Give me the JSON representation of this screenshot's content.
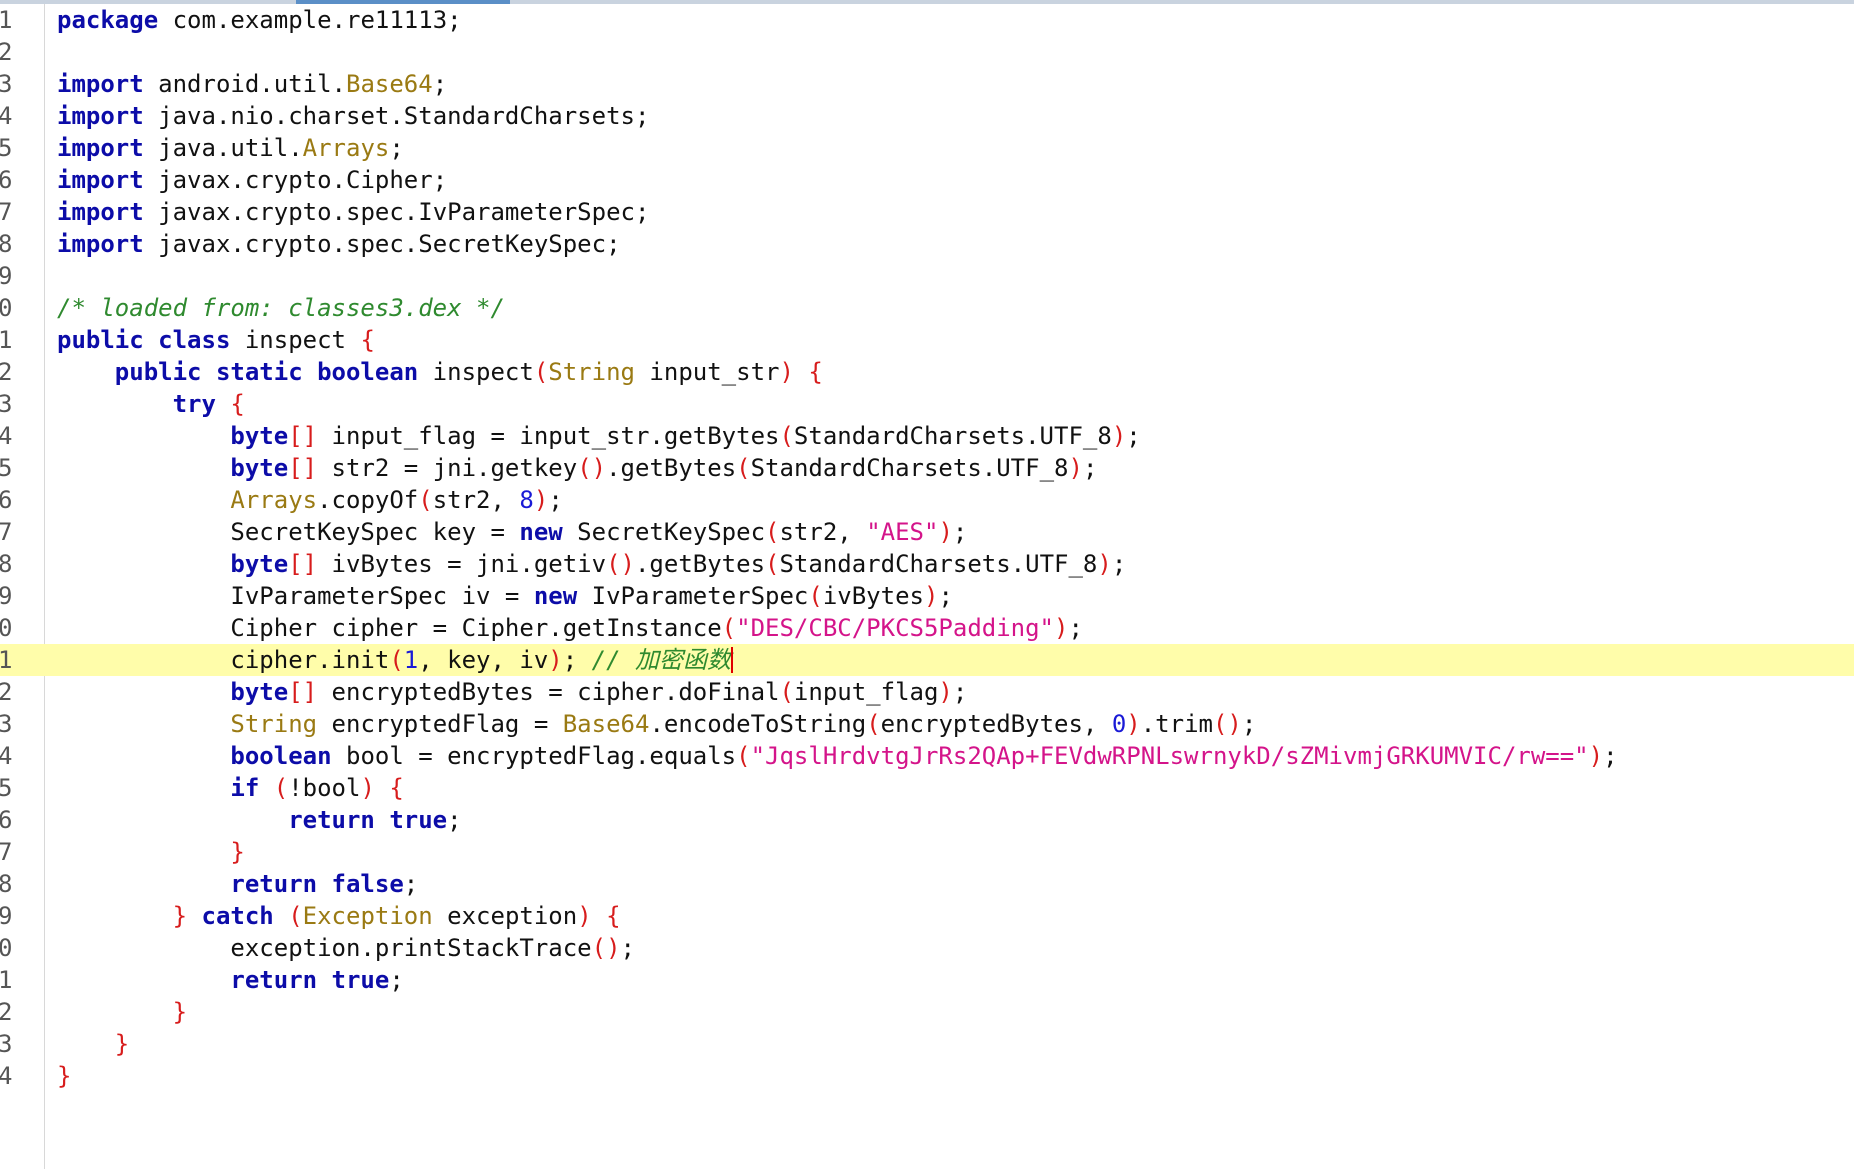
{
  "editor": {
    "current_line": 21,
    "lines": [
      {
        "n": "1",
        "tokens": [
          {
            "t": "kw",
            "v": "package"
          },
          {
            "t": "",
            "v": " com.example.re11113;"
          }
        ]
      },
      {
        "n": "2",
        "tokens": []
      },
      {
        "n": "3",
        "tokens": [
          {
            "t": "kw",
            "v": "import"
          },
          {
            "t": "",
            "v": " android.util."
          },
          {
            "t": "cls",
            "v": "Base64"
          },
          {
            "t": "",
            "v": ";"
          }
        ]
      },
      {
        "n": "4",
        "tokens": [
          {
            "t": "kw",
            "v": "import"
          },
          {
            "t": "",
            "v": " java.nio.charset.StandardCharsets;"
          }
        ]
      },
      {
        "n": "5",
        "tokens": [
          {
            "t": "kw",
            "v": "import"
          },
          {
            "t": "",
            "v": " java.util."
          },
          {
            "t": "cls",
            "v": "Arrays"
          },
          {
            "t": "",
            "v": ";"
          }
        ]
      },
      {
        "n": "6",
        "tokens": [
          {
            "t": "kw",
            "v": "import"
          },
          {
            "t": "",
            "v": " javax.crypto.Cipher;"
          }
        ]
      },
      {
        "n": "7",
        "tokens": [
          {
            "t": "kw",
            "v": "import"
          },
          {
            "t": "",
            "v": " javax.crypto.spec.IvParameterSpec;"
          }
        ]
      },
      {
        "n": "8",
        "tokens": [
          {
            "t": "kw",
            "v": "import"
          },
          {
            "t": "",
            "v": " javax.crypto.spec.SecretKeySpec;"
          }
        ]
      },
      {
        "n": "9",
        "tokens": []
      },
      {
        "n": "0",
        "tokens": [
          {
            "t": "cmt",
            "v": "/* loaded from: classes3.dex */"
          }
        ]
      },
      {
        "n": "1",
        "tokens": [
          {
            "t": "kw",
            "v": "public class"
          },
          {
            "t": "",
            "v": " inspect "
          },
          {
            "t": "br",
            "v": "{"
          }
        ]
      },
      {
        "n": "2",
        "tokens": [
          {
            "t": "",
            "v": "    "
          },
          {
            "t": "kw",
            "v": "public static boolean"
          },
          {
            "t": "",
            "v": " inspect"
          },
          {
            "t": "br",
            "v": "("
          },
          {
            "t": "cls",
            "v": "String"
          },
          {
            "t": "",
            "v": " input_str"
          },
          {
            "t": "br",
            "v": ")"
          },
          {
            "t": "",
            "v": " "
          },
          {
            "t": "br",
            "v": "{"
          }
        ]
      },
      {
        "n": "3",
        "tokens": [
          {
            "t": "",
            "v": "        "
          },
          {
            "t": "kw",
            "v": "try"
          },
          {
            "t": "",
            "v": " "
          },
          {
            "t": "br",
            "v": "{"
          }
        ]
      },
      {
        "n": "4",
        "tokens": [
          {
            "t": "",
            "v": "            "
          },
          {
            "t": "kw",
            "v": "byte"
          },
          {
            "t": "br",
            "v": "[]"
          },
          {
            "t": "",
            "v": " input_flag = input_str.getBytes"
          },
          {
            "t": "br",
            "v": "("
          },
          {
            "t": "",
            "v": "StandardCharsets.UTF_8"
          },
          {
            "t": "br",
            "v": ")"
          },
          {
            "t": "",
            "v": ";"
          }
        ]
      },
      {
        "n": "5",
        "tokens": [
          {
            "t": "",
            "v": "            "
          },
          {
            "t": "kw",
            "v": "byte"
          },
          {
            "t": "br",
            "v": "[]"
          },
          {
            "t": "",
            "v": " str2 = jni.getkey"
          },
          {
            "t": "br",
            "v": "()"
          },
          {
            "t": "",
            "v": ".getBytes"
          },
          {
            "t": "br",
            "v": "("
          },
          {
            "t": "",
            "v": "StandardCharsets.UTF_8"
          },
          {
            "t": "br",
            "v": ")"
          },
          {
            "t": "",
            "v": ";"
          }
        ]
      },
      {
        "n": "6",
        "tokens": [
          {
            "t": "",
            "v": "            "
          },
          {
            "t": "cls",
            "v": "Arrays"
          },
          {
            "t": "",
            "v": ".copyOf"
          },
          {
            "t": "br",
            "v": "("
          },
          {
            "t": "",
            "v": "str2, "
          },
          {
            "t": "num",
            "v": "8"
          },
          {
            "t": "br",
            "v": ")"
          },
          {
            "t": "",
            "v": ";"
          }
        ]
      },
      {
        "n": "7",
        "tokens": [
          {
            "t": "",
            "v": "            SecretKeySpec key = "
          },
          {
            "t": "kw",
            "v": "new"
          },
          {
            "t": "",
            "v": " SecretKeySpec"
          },
          {
            "t": "br",
            "v": "("
          },
          {
            "t": "",
            "v": "str2, "
          },
          {
            "t": "str",
            "v": "\"AES\""
          },
          {
            "t": "br",
            "v": ")"
          },
          {
            "t": "",
            "v": ";"
          }
        ]
      },
      {
        "n": "8",
        "tokens": [
          {
            "t": "",
            "v": "            "
          },
          {
            "t": "kw",
            "v": "byte"
          },
          {
            "t": "br",
            "v": "[]"
          },
          {
            "t": "",
            "v": " ivBytes = jni.getiv"
          },
          {
            "t": "br",
            "v": "()"
          },
          {
            "t": "",
            "v": ".getBytes"
          },
          {
            "t": "br",
            "v": "("
          },
          {
            "t": "",
            "v": "StandardCharsets.UTF_8"
          },
          {
            "t": "br",
            "v": ")"
          },
          {
            "t": "",
            "v": ";"
          }
        ]
      },
      {
        "n": "9",
        "tokens": [
          {
            "t": "",
            "v": "            IvParameterSpec iv = "
          },
          {
            "t": "kw",
            "v": "new"
          },
          {
            "t": "",
            "v": " IvParameterSpec"
          },
          {
            "t": "br",
            "v": "("
          },
          {
            "t": "",
            "v": "ivBytes"
          },
          {
            "t": "br",
            "v": ")"
          },
          {
            "t": "",
            "v": ";"
          }
        ]
      },
      {
        "n": "0",
        "tokens": [
          {
            "t": "",
            "v": "            Cipher cipher = Cipher.getInstance"
          },
          {
            "t": "br",
            "v": "("
          },
          {
            "t": "str",
            "v": "\"DES/CBC/PKCS5Padding\""
          },
          {
            "t": "br",
            "v": ")"
          },
          {
            "t": "",
            "v": ";"
          }
        ]
      },
      {
        "n": "1",
        "tokens": [
          {
            "t": "",
            "v": "            cipher.init"
          },
          {
            "t": "br",
            "v": "("
          },
          {
            "t": "num",
            "v": "1"
          },
          {
            "t": "",
            "v": ", key, iv"
          },
          {
            "t": "br",
            "v": ")"
          },
          {
            "t": "",
            "v": "; "
          },
          {
            "t": "cmt",
            "v": "// 加密函数"
          }
        ]
      },
      {
        "n": "2",
        "tokens": [
          {
            "t": "",
            "v": "            "
          },
          {
            "t": "kw",
            "v": "byte"
          },
          {
            "t": "br",
            "v": "[]"
          },
          {
            "t": "",
            "v": " encryptedBytes = cipher.doFinal"
          },
          {
            "t": "br",
            "v": "("
          },
          {
            "t": "",
            "v": "input_flag"
          },
          {
            "t": "br",
            "v": ")"
          },
          {
            "t": "",
            "v": ";"
          }
        ]
      },
      {
        "n": "3",
        "tokens": [
          {
            "t": "",
            "v": "            "
          },
          {
            "t": "cls",
            "v": "String"
          },
          {
            "t": "",
            "v": " encryptedFlag = "
          },
          {
            "t": "cls",
            "v": "Base64"
          },
          {
            "t": "",
            "v": ".encodeToString"
          },
          {
            "t": "br",
            "v": "("
          },
          {
            "t": "",
            "v": "encryptedBytes, "
          },
          {
            "t": "num",
            "v": "0"
          },
          {
            "t": "br",
            "v": ")"
          },
          {
            "t": "",
            "v": ".trim"
          },
          {
            "t": "br",
            "v": "()"
          },
          {
            "t": "",
            "v": ";"
          }
        ]
      },
      {
        "n": "4",
        "tokens": [
          {
            "t": "",
            "v": "            "
          },
          {
            "t": "kw",
            "v": "boolean"
          },
          {
            "t": "",
            "v": " bool = encryptedFlag.equals"
          },
          {
            "t": "br",
            "v": "("
          },
          {
            "t": "str",
            "v": "\"JqslHrdvtgJrRs2QAp+FEVdwRPNLswrnykD/sZMivmjGRKUMVIC/rw==\""
          },
          {
            "t": "br",
            "v": ")"
          },
          {
            "t": "",
            "v": ";"
          }
        ]
      },
      {
        "n": "5",
        "tokens": [
          {
            "t": "",
            "v": "            "
          },
          {
            "t": "kw",
            "v": "if"
          },
          {
            "t": "",
            "v": " "
          },
          {
            "t": "br",
            "v": "("
          },
          {
            "t": "",
            "v": "!bool"
          },
          {
            "t": "br",
            "v": ")"
          },
          {
            "t": "",
            "v": " "
          },
          {
            "t": "br",
            "v": "{"
          }
        ]
      },
      {
        "n": "6",
        "tokens": [
          {
            "t": "",
            "v": "                "
          },
          {
            "t": "kw",
            "v": "return true"
          },
          {
            "t": "",
            "v": ";"
          }
        ]
      },
      {
        "n": "7",
        "tokens": [
          {
            "t": "",
            "v": "            "
          },
          {
            "t": "br",
            "v": "}"
          }
        ]
      },
      {
        "n": "8",
        "tokens": [
          {
            "t": "",
            "v": "            "
          },
          {
            "t": "kw",
            "v": "return false"
          },
          {
            "t": "",
            "v": ";"
          }
        ]
      },
      {
        "n": "9",
        "tokens": [
          {
            "t": "",
            "v": "        "
          },
          {
            "t": "br",
            "v": "}"
          },
          {
            "t": "",
            "v": " "
          },
          {
            "t": "kw",
            "v": "catch"
          },
          {
            "t": "",
            "v": " "
          },
          {
            "t": "br",
            "v": "("
          },
          {
            "t": "cls",
            "v": "Exception"
          },
          {
            "t": "",
            "v": " exception"
          },
          {
            "t": "br",
            "v": ")"
          },
          {
            "t": "",
            "v": " "
          },
          {
            "t": "br",
            "v": "{"
          }
        ]
      },
      {
        "n": "0",
        "tokens": [
          {
            "t": "",
            "v": "            exception.printStackTrace"
          },
          {
            "t": "br",
            "v": "()"
          },
          {
            "t": "",
            "v": ";"
          }
        ]
      },
      {
        "n": "1",
        "tokens": [
          {
            "t": "",
            "v": "            "
          },
          {
            "t": "kw",
            "v": "return true"
          },
          {
            "t": "",
            "v": ";"
          }
        ]
      },
      {
        "n": "2",
        "tokens": [
          {
            "t": "",
            "v": "        "
          },
          {
            "t": "br",
            "v": "}"
          }
        ]
      },
      {
        "n": "3",
        "tokens": [
          {
            "t": "",
            "v": "    "
          },
          {
            "t": "br",
            "v": "}"
          }
        ]
      },
      {
        "n": "4",
        "tokens": [
          {
            "t": "br",
            "v": "}"
          }
        ]
      }
    ]
  }
}
